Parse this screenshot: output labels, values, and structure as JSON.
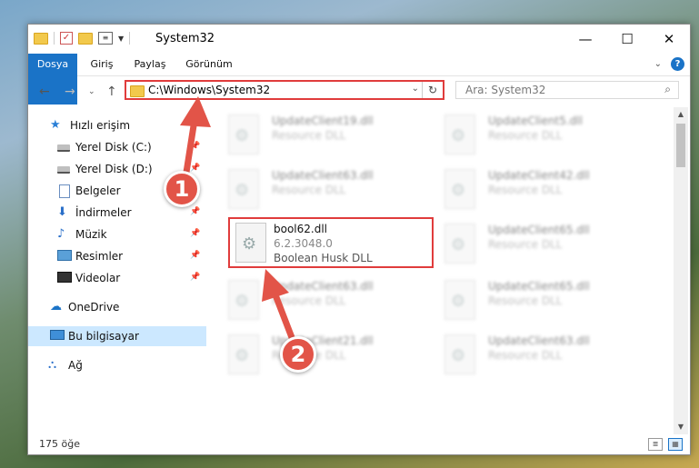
{
  "window": {
    "title": "System32",
    "min_glyph": "—",
    "max_glyph": "☐",
    "close_glyph": "✕"
  },
  "ribbon": {
    "tabs": [
      "Dosya",
      "Giriş",
      "Paylaş",
      "Görünüm"
    ],
    "help_glyph": "?"
  },
  "address": {
    "path": "C:\\Windows\\System32",
    "search_placeholder": "Ara: System32"
  },
  "sidebar": {
    "quick_access": "Hızlı erişim",
    "items": [
      {
        "label": "Yerel Disk (C:)",
        "icon": "disk-icon",
        "pinned": true
      },
      {
        "label": "Yerel Disk (D:)",
        "icon": "disk-icon",
        "pinned": true
      },
      {
        "label": "Belgeler",
        "icon": "document-icon",
        "pinned": true
      },
      {
        "label": "İndirmeler",
        "icon": "download-icon",
        "pinned": true
      },
      {
        "label": "Müzik",
        "icon": "music-icon",
        "pinned": true
      },
      {
        "label": "Resimler",
        "icon": "pictures-icon",
        "pinned": true
      },
      {
        "label": "Videolar",
        "icon": "video-icon",
        "pinned": true
      }
    ],
    "onedrive": "OneDrive",
    "this_pc": "Bu bilgisayar",
    "network": "Ağ"
  },
  "files": {
    "col1": [
      {
        "name": "UpdateClient19.dll",
        "type": "Resource DLL"
      },
      {
        "name": "UpdateClient63.dll",
        "type": "Resource DLL"
      },
      {
        "name": "UpdateClient63.dll",
        "type": "Resource DLL"
      },
      {
        "name": "UpdateClient21.dll",
        "type": "Resource DLL"
      }
    ],
    "col2": [
      {
        "name": "UpdateClient5.dll",
        "type": "Resource DLL"
      },
      {
        "name": "UpdateClient42.dll",
        "type": "Resource DLL"
      },
      {
        "name": "UpdateClient65.dll",
        "type": "Resource DLL"
      },
      {
        "name": "UpdateClient65.dll",
        "type": "Resource DLL"
      },
      {
        "name": "UpdateClient63.dll",
        "type": "Resource DLL"
      }
    ],
    "highlighted": {
      "name": "bool62.dll",
      "version": "6.2.3048.0",
      "description": "Boolean Husk DLL"
    }
  },
  "status": {
    "item_count": "175 öğe"
  },
  "callouts": [
    "1",
    "2"
  ],
  "colors": {
    "accent": "#1a73c7",
    "highlight_box": "#e03c3c",
    "callout": "#e25448",
    "selected_nav": "#cce8ff"
  }
}
